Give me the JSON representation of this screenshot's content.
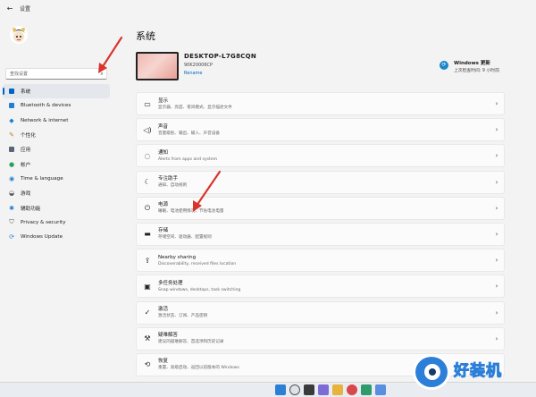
{
  "window": {
    "title": "设置",
    "back_icon": "back-arrow-icon"
  },
  "sidebar": {
    "search_placeholder": "查找设置",
    "items": [
      {
        "label": "系统",
        "active": true
      },
      {
        "label": "Bluetooth & devices"
      },
      {
        "label": "Network & internet"
      },
      {
        "label": "个性化"
      },
      {
        "label": "应用"
      },
      {
        "label": "帐户"
      },
      {
        "label": "Time & language"
      },
      {
        "label": "游戏"
      },
      {
        "label": "辅助功能"
      },
      {
        "label": "Privacy & security"
      },
      {
        "label": "Windows Update"
      }
    ]
  },
  "main": {
    "title": "系统",
    "device": {
      "name": "DESKTOP-L7G8CQN",
      "model": "90K20006CP",
      "rename": "Rename"
    },
    "update": {
      "title": "Windows 更新",
      "subtitle": "上次检查时间: 9 小时前"
    },
    "rows": [
      {
        "title": "显示",
        "subtitle": "显示器、亮度、夜间模式、显示描述文件"
      },
      {
        "title": "声音",
        "subtitle": "音量级别、输出、输入、声音设备"
      },
      {
        "title": "通知",
        "subtitle": "Alerts from apps and system"
      },
      {
        "title": "专注助手",
        "subtitle": "通知、自动规则"
      },
      {
        "title": "电源",
        "subtitle": "睡眠、电池使用情况、节省电池电量"
      },
      {
        "title": "存储",
        "subtitle": "存储空间、驱动器、配置规则"
      },
      {
        "title": "Nearby sharing",
        "subtitle": "Discoverability, received files location"
      },
      {
        "title": "多任务处理",
        "subtitle": "Snap windows, desktops, task switching"
      },
      {
        "title": "激活",
        "subtitle": "激活状态、订阅、产品密钥"
      },
      {
        "title": "疑难解答",
        "subtitle": "建议的疑难解答、首选项和历史记录"
      },
      {
        "title": "恢复",
        "subtitle": "重置、高级启动、返回以前版本的 Windows"
      }
    ]
  },
  "watermark": {
    "text": "好装机"
  },
  "colors": {
    "accent": "#0067c0",
    "arrow": "#d9342b"
  }
}
